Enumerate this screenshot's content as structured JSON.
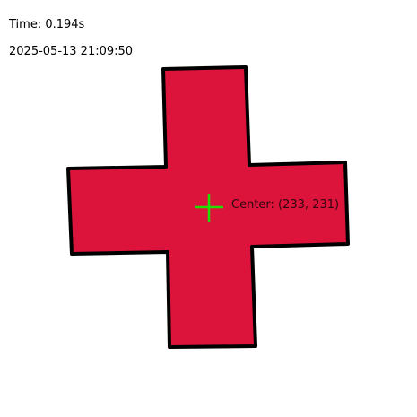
{
  "hud": {
    "time_label": "Time: 0.194s",
    "timestamp": "2025-05-13 21:09:50"
  },
  "shape": {
    "type": "cross",
    "fill_color": "#DC143C",
    "stroke_color": "#000000"
  },
  "center_marker": {
    "label": "Center: (233, 231)",
    "color": "#22DD00",
    "icon": "crosshair-icon"
  }
}
